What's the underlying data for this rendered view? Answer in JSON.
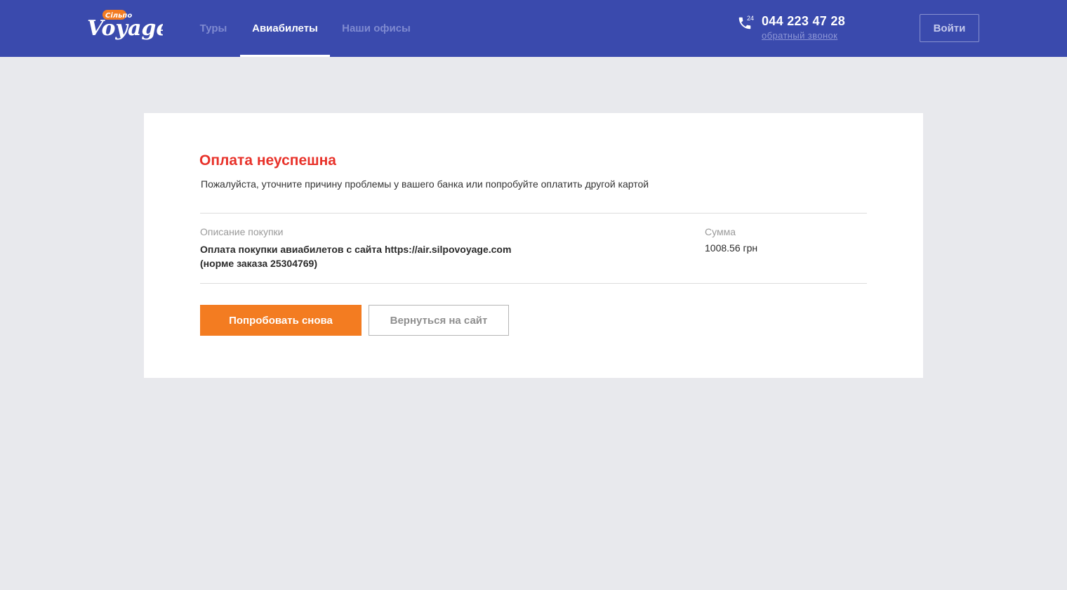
{
  "header": {
    "logo_text": "Voyage",
    "logo_badge": "Сільпо",
    "nav": [
      {
        "label": "Туры",
        "active": false
      },
      {
        "label": "Авиабилеты",
        "active": true
      },
      {
        "label": "Наши офисы",
        "active": false
      }
    ],
    "phone_badge": "24",
    "phone_number": "044 223 47 28",
    "callback_label": "обратный звонок",
    "login_label": "Войти"
  },
  "payment": {
    "title": "Оплата неуспешна",
    "subtitle": "Пожалуйста, уточните причину проблемы у вашего банка или попробуйте оплатить другой картой",
    "description_label": "Описание покупки",
    "description_line1": "Оплата покупки авиабилетов с сайта https://air.silpovoyage.com",
    "description_line2": "(норме заказа 25304769)",
    "sum_label": "Сумма",
    "sum_value": "1008.56 грн",
    "retry_label": "Попробовать снова",
    "back_label": "Вернуться на сайт"
  },
  "colors": {
    "header_bg": "#3a4aad",
    "page_bg": "#e8e9ed",
    "error_red": "#e8322a",
    "accent_orange": "#f37c21"
  },
  "icons": {
    "phone": "phone-icon"
  }
}
